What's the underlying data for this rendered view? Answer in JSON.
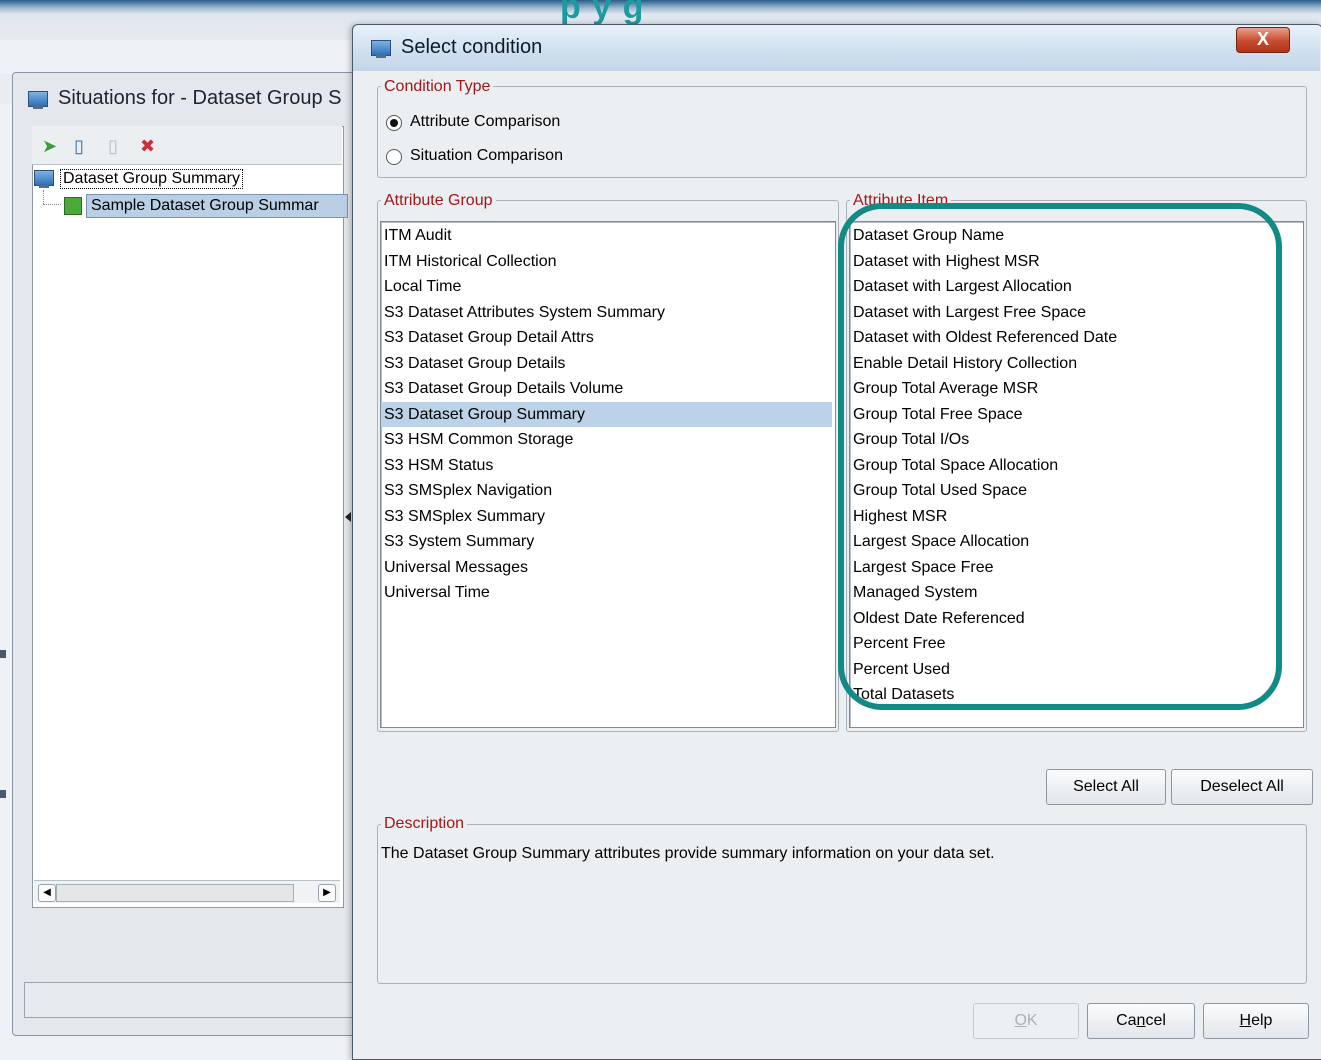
{
  "banner": {
    "title_fragment": "p y  g"
  },
  "situations_window": {
    "title": "Situations for - Dataset Group S",
    "tree": {
      "root_label": "Dataset Group Summary",
      "child_label": "Sample Dataset Group Summar"
    }
  },
  "dialog": {
    "title": "Select condition",
    "close_label": "X",
    "condition_type": {
      "legend": "Condition Type",
      "options": [
        "Attribute Comparison",
        "Situation Comparison"
      ],
      "selected": "Attribute Comparison"
    },
    "attribute_group": {
      "legend": "Attribute Group",
      "items": [
        "ITM Audit",
        "ITM Historical Collection",
        "Local Time",
        "S3 Dataset Attributes System Summary",
        "S3 Dataset Group Detail Attrs",
        "S3 Dataset Group Details",
        "S3 Dataset Group Details Volume",
        "S3 Dataset Group Summary",
        "S3 HSM Common Storage",
        "S3 HSM Status",
        "S3 SMSplex Navigation",
        "S3 SMSplex Summary",
        "S3 System Summary",
        "Universal Messages",
        "Universal Time"
      ],
      "selected": "S3 Dataset Group Summary"
    },
    "attribute_item": {
      "legend": "Attribute Item",
      "items": [
        "Dataset Group Name",
        "Dataset with Highest MSR",
        "Dataset with Largest Allocation",
        "Dataset with Largest Free Space",
        "Dataset with Oldest Referenced Date",
        "Enable Detail History Collection",
        "Group Total Average MSR",
        "Group Total Free Space",
        "Group Total I/Os",
        "Group Total Space Allocation",
        "Group Total Used Space",
        "Highest MSR",
        "Largest Space Allocation",
        "Largest Space Free",
        "Managed System",
        "Oldest Date Referenced",
        "Percent Free",
        "Percent Used",
        "Total Datasets"
      ]
    },
    "select_all_label": "Select All",
    "deselect_all_label": "Deselect All",
    "description": {
      "legend": "Description",
      "text": "The Dataset Group Summary attributes provide summary information on your data set."
    },
    "buttons": {
      "ok": {
        "label": "OK",
        "mnemonic": "O",
        "rest": "K"
      },
      "cancel": {
        "label": "Cancel",
        "pre": "Ca",
        "mnemonic": "n",
        "rest": "cel"
      },
      "help": {
        "label": "Help",
        "mnemonic": "H",
        "rest": "elp"
      }
    },
    "highlight_color": "#138a86",
    "legend_color": "#a01818",
    "selection_color": "#bcd2e8"
  }
}
